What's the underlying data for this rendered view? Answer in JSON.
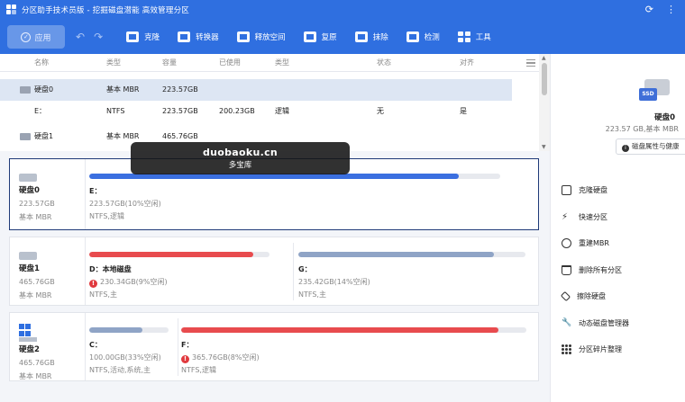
{
  "window": {
    "title": "分区助手技术员版 - 挖掘磁盘潜能 高效管理分区",
    "controls": [
      "⟳",
      "⋮"
    ]
  },
  "toolbar": {
    "apply_label": "应用",
    "tools": [
      {
        "label": "克隆",
        "icon": "clone-icon"
      },
      {
        "label": "转换器",
        "icon": "converter-icon"
      },
      {
        "label": "释放空间",
        "icon": "free-space-icon"
      },
      {
        "label": "复原",
        "icon": "restore-icon"
      },
      {
        "label": "抹除",
        "icon": "wipe-icon"
      },
      {
        "label": "检测",
        "icon": "check-icon"
      },
      {
        "label": "工具",
        "icon": "tools-grid-icon"
      }
    ]
  },
  "list": {
    "columns": [
      "名称",
      "类型",
      "容量",
      "已使用",
      "类型",
      "状态",
      "对齐"
    ],
    "rows": [
      {
        "name": "硬盘0",
        "type": "基本 MBR",
        "capacity": "223.57GB",
        "used": "",
        "fs": "",
        "status": "",
        "align": "",
        "selected": true
      },
      {
        "name": "E：",
        "type": "NTFS",
        "capacity": "223.57GB",
        "used": "200.23GB",
        "fs": "逻辑",
        "status": "无",
        "align": "是",
        "selected": false
      },
      {
        "name": "硬盘1",
        "type": "基本 MBR",
        "capacity": "465.76GB",
        "used": "",
        "fs": "",
        "status": "",
        "align": "",
        "selected": false
      }
    ]
  },
  "watermark": {
    "line1": "duobaoku.cn",
    "line2": "多宝库"
  },
  "disks": [
    {
      "name": "硬盘0",
      "size": "223.57GB",
      "type": "基本 MBR",
      "selected": true,
      "partitions": [
        {
          "label": "E：",
          "size": "223.57GB(10%空闲)",
          "fs": "NTFS,逻辑",
          "used_fraction": 0.9,
          "color": "#3b6fe0",
          "warning": false
        }
      ]
    },
    {
      "name": "硬盘1",
      "size": "465.76GB",
      "type": "基本 MBR",
      "selected": false,
      "partitions": [
        {
          "label": "D：本地磁盘",
          "size": "230.34GB(9%空闲)",
          "fs": "NTFS,主",
          "used_fraction": 0.91,
          "color": "#e84b4e",
          "warning": true
        },
        {
          "label": "G：",
          "size": "235.42GB(14%空闲)",
          "fs": "NTFS,主",
          "used_fraction": 0.86,
          "color": "#8fa4c6",
          "warning": false
        }
      ]
    },
    {
      "name": "硬盘2",
      "size": "465.76GB",
      "type": "基本 MBR",
      "selected": false,
      "partitions": [
        {
          "label": "C：",
          "size": "100.00GB(33%空闲)",
          "fs": "NTFS,活动,系统,主",
          "used_fraction": 0.67,
          "color": "#8fa4c6",
          "warning": false
        },
        {
          "label": "F：",
          "size": "365.76GB(8%空闲)",
          "fs": "NTFS,逻辑",
          "used_fraction": 0.92,
          "color": "#e84b4e",
          "warning": true
        }
      ]
    }
  ],
  "right_panel": {
    "disk_badge": "SSD",
    "disk_name": "硬盘0",
    "disk_size": "223.57 GB,基本 MBR",
    "properties_button": "磁盘属性与健康",
    "operations": [
      {
        "label": "克隆硬盘",
        "icon": "clone-disk-icon"
      },
      {
        "label": "快速分区",
        "icon": "quick-partition-icon"
      },
      {
        "label": "重建MBR",
        "icon": "rebuild-mbr-icon"
      },
      {
        "label": "删除所有分区",
        "icon": "delete-all-icon"
      },
      {
        "label": "擦除硬盘",
        "icon": "wipe-disk-icon"
      },
      {
        "label": "动态磁盘管理器",
        "icon": "dynamic-disk-icon"
      },
      {
        "label": "分区碎片整理",
        "icon": "defrag-icon"
      }
    ]
  }
}
